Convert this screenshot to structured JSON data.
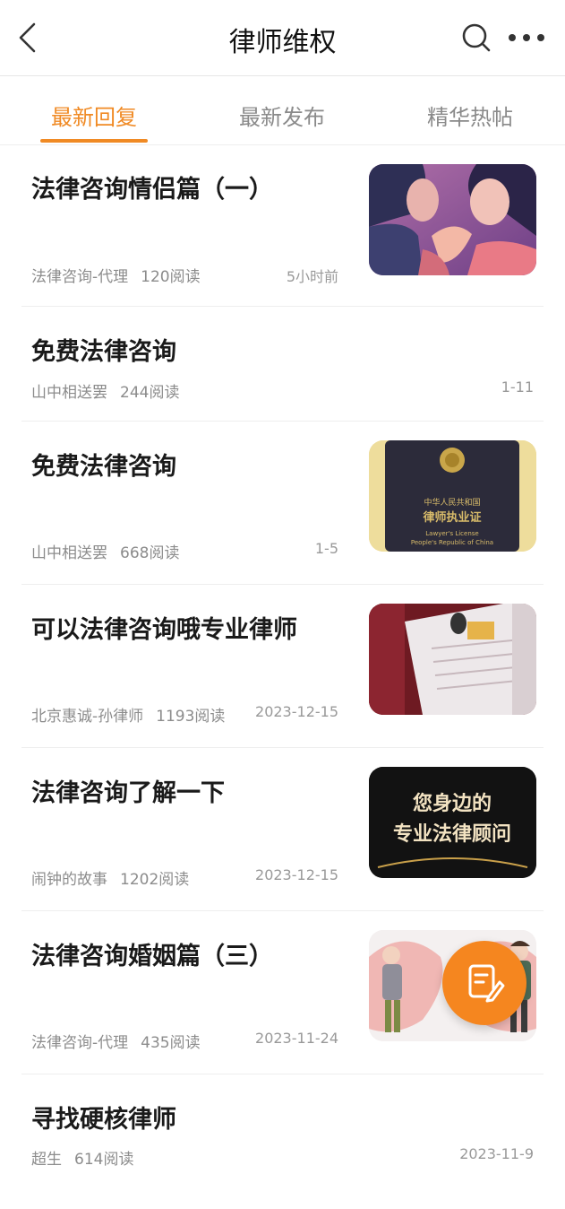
{
  "header": {
    "title": "律师维权",
    "back_icon": "back-chevron-icon",
    "search_icon": "search-icon",
    "more_icon": "more-dots-icon"
  },
  "tabs": [
    {
      "label": "最新回复",
      "active": true
    },
    {
      "label": "最新发布",
      "active": false
    },
    {
      "label": "精华热帖",
      "active": false
    }
  ],
  "colors": {
    "accent": "#f08a24",
    "fab": "#f5861f"
  },
  "posts": [
    {
      "title": "法律咨询情侣篇（一）",
      "author": "法律咨询-代理",
      "reads": "120阅读",
      "time": "5小时前",
      "thumbnail": "couple-illustration"
    },
    {
      "title": "免费法律咨询",
      "author": "山中相送罢",
      "reads": "244阅读",
      "time": "1-11"
    },
    {
      "title": "免费法律咨询",
      "author": "山中相送罢",
      "reads": "668阅读",
      "time": "1-5",
      "thumbnail": "lawyer-license-photo",
      "thumb_text": [
        "中华人民共和国",
        "律师执业证",
        "Lawyer's License",
        "People's Republic of China"
      ]
    },
    {
      "title": "可以法律咨询哦专业律师",
      "author": "北京惠诚-孙律师",
      "reads": "1193阅读",
      "time": "2023-12-15",
      "thumbnail": "certificate-photo"
    },
    {
      "title": "法律咨询了解一下",
      "author": "闹钟的故事",
      "reads": "1202阅读",
      "time": "2023-12-15",
      "thumbnail": "legal-advisor-banner",
      "thumb_text": [
        "您身边的",
        "专业法律顾问"
      ]
    },
    {
      "title": "法律咨询婚姻篇（三）",
      "author": "法律咨询-代理",
      "reads": "435阅读",
      "time": "2023-11-24",
      "thumbnail": "marriage-illustration"
    },
    {
      "title": "寻找硬核律师",
      "author": "超生",
      "reads": "614阅读",
      "time": "2023-11-9"
    }
  ],
  "fab": {
    "icon": "compose-edit-icon"
  }
}
